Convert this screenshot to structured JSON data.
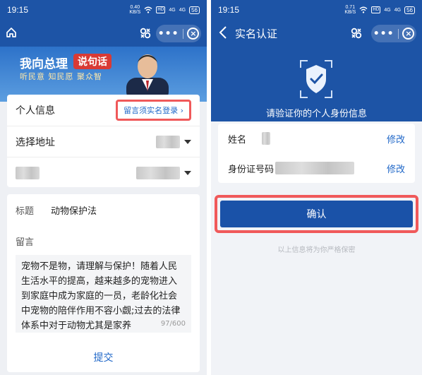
{
  "left": {
    "status": {
      "time": "19:15",
      "speed_value": "0.40",
      "speed_unit": "KB/S",
      "hd": "HD",
      "signal1": "4G",
      "signal2": "4G",
      "battery": "56"
    },
    "banner": {
      "slogan": "我向总理",
      "speak": "说句话",
      "sub": "听民意 知民愿 聚众智"
    },
    "info_card": {
      "personal_info_label": "个人信息",
      "login_hint": "留言须实名登录",
      "address_label": "选择地址"
    },
    "message_card": {
      "title_label": "标题",
      "title_value": "动物保护法",
      "message_label": "留言",
      "message_text": "宠物不是物，请理解与保护！随着人民生活水平的提高，越来越多的宠物进入到家庭中成为家庭的一员，老龄化社会中宠物的陪伴作用不容小觑;过去的法律体系中对于动物尤其是家养",
      "counter": "97/600",
      "submit_label": "提交"
    }
  },
  "right": {
    "status": {
      "time": "19:15",
      "speed_value": "0.71",
      "speed_unit": "KB/S",
      "hd": "HD",
      "signal1": "4G",
      "signal2": "4G",
      "battery": "56"
    },
    "title": "实名认证",
    "verify_text": "请验证你的个人身份信息",
    "name_label": "姓名",
    "id_label": "身份证号码",
    "modify_label": "修改",
    "confirm_label": "确认",
    "privacy_text": "以上信息将为你严格保密"
  },
  "colors": {
    "primary": "#1d54a6",
    "link": "#1f67c8",
    "highlight": "#f0595a"
  }
}
